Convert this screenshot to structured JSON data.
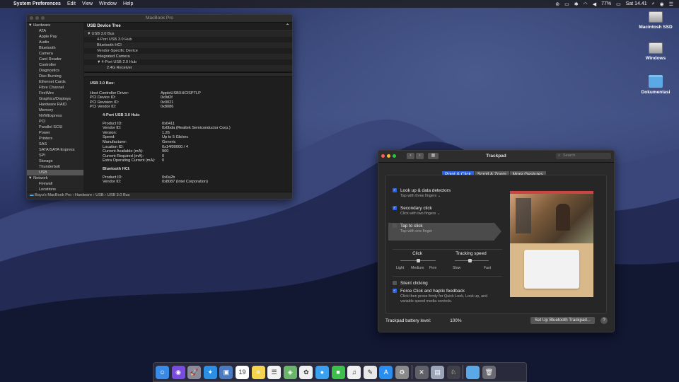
{
  "menubar": {
    "apple": "",
    "app": "System Preferences",
    "menus": [
      "Edit",
      "View",
      "Window",
      "Help"
    ],
    "battery": "77%",
    "clock": "Sat 14.41"
  },
  "desktop": {
    "icons": [
      {
        "label": "Macintosh SSD",
        "kind": "disk"
      },
      {
        "label": "Windows",
        "kind": "disk"
      },
      {
        "label": "Dokumentasi",
        "kind": "folder"
      }
    ]
  },
  "sysinfo": {
    "title": "MacBook Pro",
    "sidebar": [
      {
        "label": "Hardware",
        "type": "group"
      },
      {
        "label": "ATA"
      },
      {
        "label": "Apple Pay"
      },
      {
        "label": "Audio"
      },
      {
        "label": "Bluetooth"
      },
      {
        "label": "Camera"
      },
      {
        "label": "Card Reader"
      },
      {
        "label": "Controller"
      },
      {
        "label": "Diagnostics"
      },
      {
        "label": "Disc Burning"
      },
      {
        "label": "Ethernet Cards"
      },
      {
        "label": "Fibre Channel"
      },
      {
        "label": "FireWire"
      },
      {
        "label": "Graphics/Displays"
      },
      {
        "label": "Hardware RAID"
      },
      {
        "label": "Memory"
      },
      {
        "label": "NVMExpress"
      },
      {
        "label": "PCI"
      },
      {
        "label": "Parallel SCSI"
      },
      {
        "label": "Power"
      },
      {
        "label": "Printers"
      },
      {
        "label": "SAS"
      },
      {
        "label": "SATA/SATA Express"
      },
      {
        "label": "SPI"
      },
      {
        "label": "Storage"
      },
      {
        "label": "Thunderbolt"
      },
      {
        "label": "USB",
        "selected": true
      },
      {
        "label": "Network",
        "type": "group"
      },
      {
        "label": "Firewall"
      },
      {
        "label": "Locations"
      }
    ],
    "tree_header": "USB Device Tree",
    "tree": [
      {
        "label": "USB 3.0 Bus",
        "level": 0,
        "caret": "▼"
      },
      {
        "label": "4-Port USB 3.0 Hub",
        "level": 1
      },
      {
        "label": "Bluetooth HCI",
        "level": 1
      },
      {
        "label": "Vendor-Specific Device",
        "level": 1
      },
      {
        "label": "Integrated Camera",
        "level": 1
      },
      {
        "label": "4-Port USB 2.0 Hub",
        "level": 1,
        "caret": "▼"
      },
      {
        "label": "2.4G Receiver",
        "level": 2
      }
    ],
    "detail_title": "USB 3.0 Bus:",
    "bus_props": [
      {
        "k": "Host Controller Driver:",
        "v": "AppleUSBXHCISPTLP"
      },
      {
        "k": "PCI Device ID:",
        "v": "0x9d2f"
      },
      {
        "k": "PCI Revision ID:",
        "v": "0x0021"
      },
      {
        "k": "PCI Vendor ID:",
        "v": "0x8086"
      }
    ],
    "hub_title": "4-Port USB 3.0 Hub:",
    "hub_props": [
      {
        "k": "Product ID:",
        "v": "0x0411"
      },
      {
        "k": "Vendor ID:",
        "v": "0x0bda  (Realtek Semiconductor Corp.)"
      },
      {
        "k": "Version:",
        "v": "1.26"
      },
      {
        "k": "Speed:",
        "v": "Up to 5 Gb/sec"
      },
      {
        "k": "Manufacturer:",
        "v": "Generic"
      },
      {
        "k": "Location ID:",
        "v": "0x14f00000 / 4"
      },
      {
        "k": "Current Available (mA):",
        "v": "900"
      },
      {
        "k": "Current Required (mA):",
        "v": "0"
      },
      {
        "k": "Extra Operating Current (mA):",
        "v": "0"
      }
    ],
    "bt_title": "Bluetooth HCI:",
    "bt_props": [
      {
        "k": "Product ID:",
        "v": "0x0a2b"
      },
      {
        "k": "Vendor ID:",
        "v": "0x8087  (Intel Corporation)"
      }
    ],
    "status_path": "Bayu's MacBook Pro › Hardware › USB › USB 3.0 Bus"
  },
  "trackpad": {
    "title": "Trackpad",
    "search_placeholder": "Search",
    "tabs": [
      {
        "label": "Point & Click",
        "active": true
      },
      {
        "label": "Scroll & Zoom"
      },
      {
        "label": "More Gestures"
      }
    ],
    "options": [
      {
        "label": "Look up & data detectors",
        "sub": "Tap with three fingers ⌄",
        "checked": true
      },
      {
        "label": "Secondary click",
        "sub": "Click with two fingers ⌄",
        "checked": true
      },
      {
        "label": "Tap to click",
        "sub": "Tap with one finger",
        "checked": false
      }
    ],
    "click_label": "Click",
    "click_ticks": [
      "Light",
      "Medium",
      "Firm"
    ],
    "click_value": 0.5,
    "speed_label": "Tracking speed",
    "speed_ticks": [
      "Slow",
      "Fast"
    ],
    "speed_value": 0.45,
    "silent": {
      "label": "Silent clicking",
      "checked": false
    },
    "force": {
      "label": "Force Click and haptic feedback",
      "sub": "Click then press firmly for Quick Look, Look up, and variable speed media controls.",
      "checked": true
    },
    "battery_label": "Trackpad battery level:",
    "battery_value": "100%",
    "setup_button": "Set Up Bluetooth Trackpad...",
    "help": "?"
  },
  "dock": {
    "apps": [
      {
        "name": "finder-icon",
        "glyph": "☺",
        "color": "#3a8be8"
      },
      {
        "name": "siri-icon",
        "glyph": "◉",
        "color": "#7a4be0"
      },
      {
        "name": "launchpad-icon",
        "glyph": "🚀",
        "color": "#8a8a9a"
      },
      {
        "name": "safari-icon",
        "glyph": "✦",
        "color": "#2b8fe6"
      },
      {
        "name": "photo-viewer-icon",
        "glyph": "▣",
        "color": "#4a7ac0"
      },
      {
        "name": "calendar-icon",
        "glyph": "19",
        "color": "#ffffff"
      },
      {
        "name": "notes-icon",
        "glyph": "≡",
        "color": "#f4d44e"
      },
      {
        "name": "reminders-icon",
        "glyph": "☰",
        "color": "#f2f2f2"
      },
      {
        "name": "maps-icon",
        "glyph": "◈",
        "color": "#6ab56a"
      },
      {
        "name": "photos-icon",
        "glyph": "✿",
        "color": "#f0f0f0"
      },
      {
        "name": "messages-icon",
        "glyph": "●",
        "color": "#3aa0f0"
      },
      {
        "name": "facetime-icon",
        "glyph": "■",
        "color": "#3cc04a"
      },
      {
        "name": "itunes-icon",
        "glyph": "♫",
        "color": "#f0f0f0"
      },
      {
        "name": "pages-icon",
        "glyph": "✎",
        "color": "#e8e8e8"
      },
      {
        "name": "app-store-icon",
        "glyph": "A",
        "color": "#2a8ef0"
      },
      {
        "name": "system-preferences-icon",
        "glyph": "⚙",
        "color": "#8a8a8a"
      },
      {
        "name": "separator",
        "glyph": "",
        "color": ""
      },
      {
        "name": "utilities-icon",
        "glyph": "✕",
        "color": "#606068"
      },
      {
        "name": "preview-icon",
        "glyph": "▤",
        "color": "#9aa6b8"
      },
      {
        "name": "script-icon",
        "glyph": "♘",
        "color": "#404048"
      },
      {
        "name": "separator",
        "glyph": "",
        "color": ""
      },
      {
        "name": "downloads-folder-icon",
        "glyph": "",
        "color": "#5aa9e6"
      },
      {
        "name": "trash-icon",
        "glyph": "🗑",
        "color": "#6a6a72"
      }
    ]
  }
}
